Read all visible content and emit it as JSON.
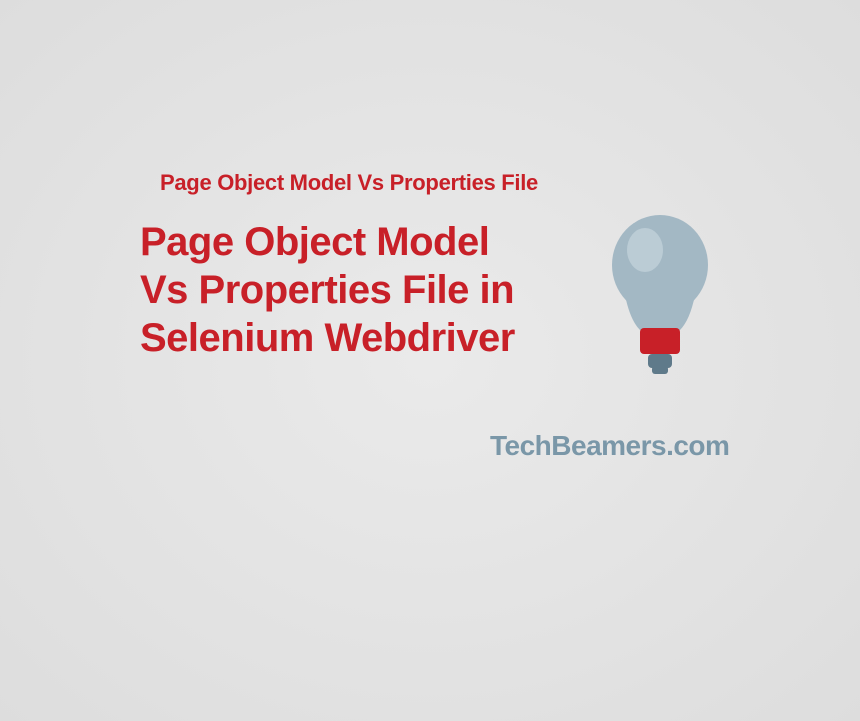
{
  "header": {
    "subtitle": "Page Object Model Vs Properties File",
    "title_line1": "Page Object Model",
    "title_line2": "Vs Properties File in",
    "title_line3": "Selenium Webdriver"
  },
  "brand": {
    "name": "TechBeamers.com"
  },
  "icon": {
    "name": "lightbulb-icon",
    "bulb_color": "#a3b8c4",
    "highlight_color": "#c5d4dd",
    "base_color": "#c82028",
    "tip_color": "#5f7a8a"
  }
}
